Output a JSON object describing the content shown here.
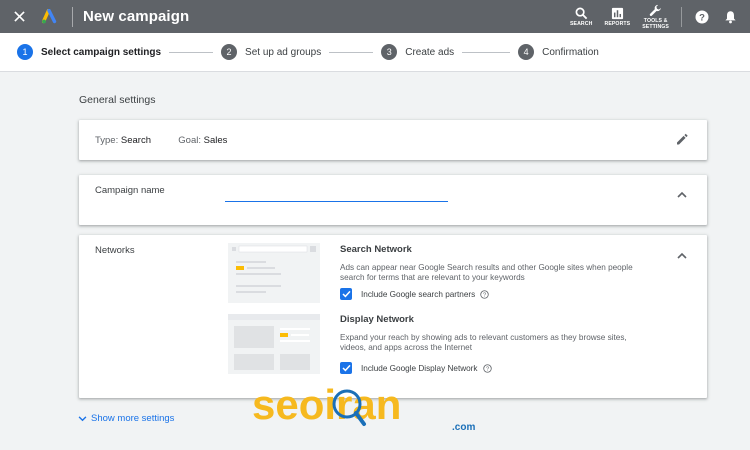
{
  "header": {
    "title": "New campaign",
    "tools": [
      {
        "icon": "search-icon",
        "label": "SEARCH"
      },
      {
        "icon": "reports-icon",
        "label": "REPORTS"
      },
      {
        "icon": "wrench-icon",
        "label_line1": "TOOLS &",
        "label_line2": "SETTINGS"
      }
    ]
  },
  "stepper": {
    "steps": [
      {
        "num": "1",
        "label": "Select campaign settings",
        "active": true
      },
      {
        "num": "2",
        "label": "Set up ad groups",
        "active": false
      },
      {
        "num": "3",
        "label": "Create ads",
        "active": false
      },
      {
        "num": "4",
        "label": "Confirmation",
        "active": false
      }
    ]
  },
  "general": {
    "section_title": "General settings",
    "type_label": "Type:",
    "type_value": "Search",
    "goal_label": "Goal:",
    "goal_value": "Sales"
  },
  "campaign_name": {
    "label": "Campaign name",
    "value": ""
  },
  "networks": {
    "label": "Networks",
    "search": {
      "title": "Search Network",
      "description": "Ads can appear near Google Search results and other Google sites when people search for terms that are relevant to your keywords",
      "checkbox_label": "Include Google search partners",
      "checked": true
    },
    "display": {
      "title": "Display Network",
      "description": "Expand your reach by showing ads to relevant customers as they browse sites, videos, and apps across the Internet",
      "checkbox_label": "Include Google Display Network",
      "checked": true
    }
  },
  "show_more": "Show more settings",
  "watermark": {
    "text": "seoiran",
    "suffix": ".com"
  },
  "colors": {
    "topbar": "#5f6368",
    "accent": "#1a73e8",
    "watermark": "#f6b91f"
  }
}
